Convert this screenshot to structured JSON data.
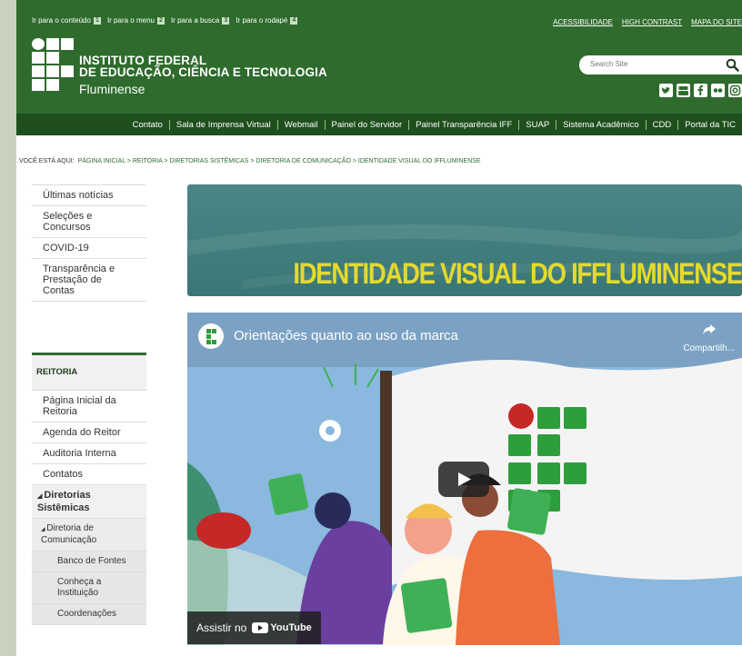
{
  "skip_links": [
    {
      "label": "Ir para o conteúdo",
      "key": "1"
    },
    {
      "label": "Ir para o menu",
      "key": "2"
    },
    {
      "label": "Ir para a busca",
      "key": "3"
    },
    {
      "label": "Ir para o rodapé",
      "key": "4"
    }
  ],
  "top_links": [
    "ACESSIBILIDADE",
    "HIGH CONTRAST",
    "MAPA DO SITE"
  ],
  "institute": {
    "line1": "INSTITUTO FEDERAL",
    "line2": "DE EDUCAÇÃO, CIÊNCIA E TECNOLOGIA",
    "line3": "Fluminense"
  },
  "search": {
    "placeholder": "Search Site"
  },
  "social_icons": [
    "twitter-icon",
    "youtube-icon",
    "facebook-icon",
    "flickr-icon",
    "instagram-icon"
  ],
  "navbar": [
    "Contato",
    "Sala de Imprensa Virtual",
    "Webmail",
    "Painel do Servidor",
    "Painel Transparência IFF",
    "SUAP",
    "Sistema Acadêmico",
    "CDD",
    "Portal da TIC"
  ],
  "breadcrumb": {
    "prefix": "VOCÊ ESTÁ AQUI:",
    "items": [
      "PÁGINA INICIAL",
      "REITORIA",
      "DIRETORIAS SISTÊMICAS",
      "DIRETORIA DE COMUNICAÇÃO",
      "IDENTIDADE VISUAL DO IFFLUMINENSE"
    ],
    "separator": ">"
  },
  "sidebar_top": [
    "Últimas notícias",
    "Seleções e Concursos",
    "COVID-19",
    "Transparência e Prestação de Contas"
  ],
  "reitoria": {
    "heading": "REITORIA",
    "items": [
      "Página Inicial da Reitoria",
      "Agenda do Reitor",
      "Auditoria Interna",
      "Contatos"
    ],
    "diretorias": "Diretorias Sistêmicas",
    "diretoria_com": "Diretoria de Comunicação",
    "sub_items": [
      "Banco de Fontes",
      "Conheça a Instituição",
      "Coordenações"
    ]
  },
  "banner": {
    "title": "IDENTIDADE VISUAL DO IFFLUMINENSE"
  },
  "video": {
    "title": "Orientações quanto ao uso da marca",
    "share_label": "Compartilh...",
    "watch_on": "Assistir no",
    "youtube": "YouTube"
  },
  "colors": {
    "header_green": "#2e6b2d",
    "nav_green": "#1e4f1d",
    "banner_teal": "#3b7676",
    "banner_text": "#e3da2c",
    "video_sky": "#8ab8de"
  }
}
